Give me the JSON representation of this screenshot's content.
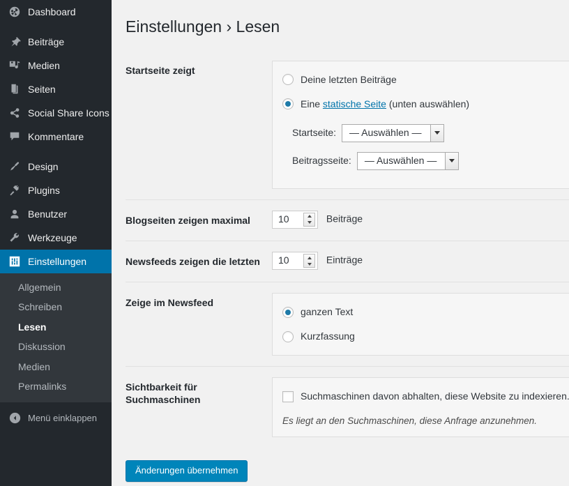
{
  "sidebar": {
    "items": [
      {
        "label": "Dashboard",
        "icon": "dashboard-icon"
      },
      {
        "label": "Beiträge",
        "icon": "pin-icon"
      },
      {
        "label": "Medien",
        "icon": "media-icon"
      },
      {
        "label": "Seiten",
        "icon": "pages-icon"
      },
      {
        "label": "Social Share Icons",
        "icon": "share-icon"
      },
      {
        "label": "Kommentare",
        "icon": "comment-icon"
      },
      {
        "label": "Design",
        "icon": "brush-icon"
      },
      {
        "label": "Plugins",
        "icon": "plug-icon"
      },
      {
        "label": "Benutzer",
        "icon": "user-icon"
      },
      {
        "label": "Werkzeuge",
        "icon": "wrench-icon"
      },
      {
        "label": "Einstellungen",
        "icon": "settings-icon"
      }
    ],
    "submenu": [
      {
        "label": "Allgemein"
      },
      {
        "label": "Schreiben"
      },
      {
        "label": "Lesen"
      },
      {
        "label": "Diskussion"
      },
      {
        "label": "Medien"
      },
      {
        "label": "Permalinks"
      }
    ],
    "collapse_label": "Menü einklappen",
    "accent_color": "#0073aa",
    "background_color": "#23282d",
    "submenu_background_color": "#32373c"
  },
  "page": {
    "title": "Einstellungen › Lesen"
  },
  "settings": {
    "front_page": {
      "label": "Startseite zeigt",
      "option_posts": "Deine letzten Beiträge",
      "option_static_prefix": "Eine ",
      "option_static_link": "statische Seite",
      "option_static_suffix": " (unten auswählen)",
      "front_page_label": "Startseite:",
      "front_page_value": "— Auswählen —",
      "posts_page_label": "Beitragsseite:",
      "posts_page_value": "— Auswählen —"
    },
    "posts_per_page": {
      "label": "Blogseiten zeigen maximal",
      "value": "10",
      "unit": "Beiträge"
    },
    "posts_per_rss": {
      "label": "Newsfeeds zeigen die letzten",
      "value": "10",
      "unit": "Einträge"
    },
    "feed_shows": {
      "label": "Zeige im Newsfeed",
      "option_full": "ganzen Text",
      "option_summary": "Kurzfassung"
    },
    "search_visibility": {
      "label_line1": "Sichtbarkeit für",
      "label_line2": "Suchmaschinen",
      "checkbox_label": "Suchmaschinen davon abhalten, diese Website zu indexieren.",
      "note": "Es liegt an den Suchmaschinen, diese Anfrage anzunehmen."
    }
  },
  "submit": {
    "label": "Änderungen übernehmen",
    "color": "#0085ba"
  }
}
